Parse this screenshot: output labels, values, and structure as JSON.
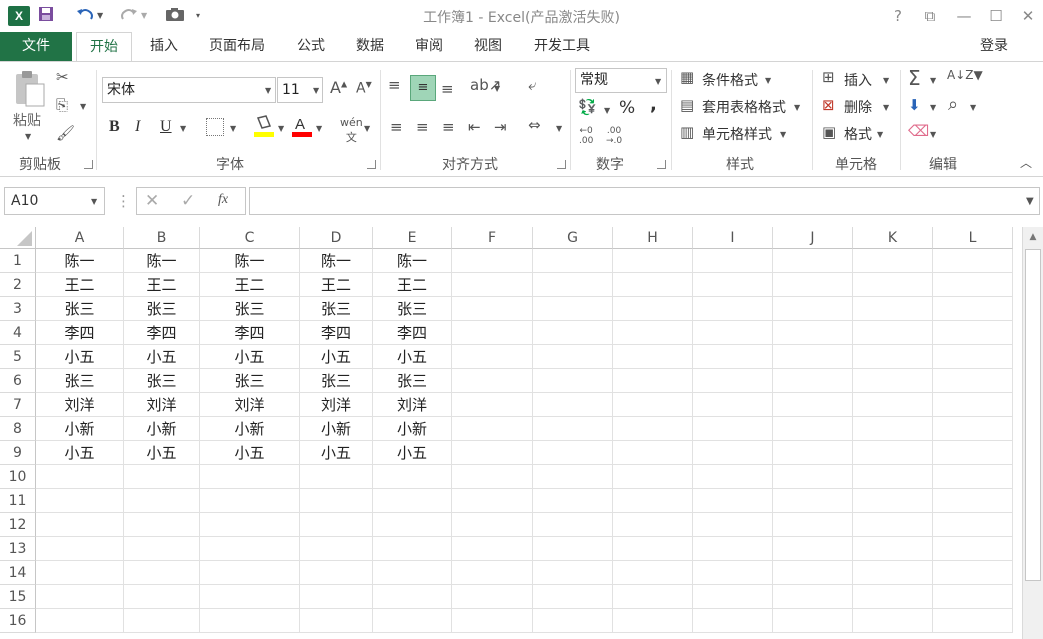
{
  "window": {
    "title": "工作簿1 - Excel(产品激活失败)",
    "help": "?",
    "restore_ribbon": "⧉",
    "minimize": "—",
    "maximize": "☐",
    "close": "✕"
  },
  "tabs": [
    "文件",
    "开始",
    "插入",
    "页面布局",
    "公式",
    "数据",
    "审阅",
    "视图",
    "开发工具"
  ],
  "active_tab": "开始",
  "login": "登录",
  "ribbon": {
    "clipboard": {
      "paste": "粘贴",
      "label": "剪贴板"
    },
    "font": {
      "name": "宋体",
      "size": "11",
      "bold": "B",
      "italic": "I",
      "underline": "U",
      "label": "字体"
    },
    "alignment": {
      "label": "对齐方式"
    },
    "number": {
      "format": "常规",
      "percent": "%",
      "comma": ",",
      "label": "数字"
    },
    "styles": {
      "conditional": "条件格式",
      "table": "套用表格格式",
      "cell": "单元格样式",
      "label": "样式"
    },
    "cells": {
      "insert": "插入",
      "delete": "删除",
      "format": "格式",
      "label": "单元格"
    },
    "editing": {
      "label": "编辑"
    }
  },
  "formula_bar": {
    "name_box": "A10",
    "fx": "fx",
    "formula": ""
  },
  "columns": [
    "A",
    "B",
    "C",
    "D",
    "E",
    "F",
    "G",
    "H",
    "I",
    "J",
    "K",
    "L"
  ],
  "rows": [
    "1",
    "2",
    "3",
    "4",
    "5",
    "6",
    "7",
    "8",
    "9",
    "10",
    "11",
    "12",
    "13",
    "14",
    "15",
    "16"
  ],
  "cells": [
    [
      "陈一",
      "陈一",
      "陈一",
      "陈一",
      "陈一"
    ],
    [
      "王二",
      "王二",
      "王二",
      "王二",
      "王二"
    ],
    [
      "张三",
      "张三",
      "张三",
      "张三",
      "张三"
    ],
    [
      "李四",
      "李四",
      "李四",
      "李四",
      "李四"
    ],
    [
      "小五",
      "小五",
      "小五",
      "小五",
      "小五"
    ],
    [
      "张三",
      "张三",
      "张三",
      "张三",
      "张三"
    ],
    [
      "刘洋",
      "刘洋",
      "刘洋",
      "刘洋",
      "刘洋"
    ],
    [
      "小新",
      "小新",
      "小新",
      "小新",
      "小新"
    ],
    [
      "小五",
      "小五",
      "小五",
      "小五",
      "小五"
    ]
  ],
  "colors": {
    "accent": "#217346",
    "fill_highlight": "#ffff00",
    "font_color": "#ff0000"
  }
}
